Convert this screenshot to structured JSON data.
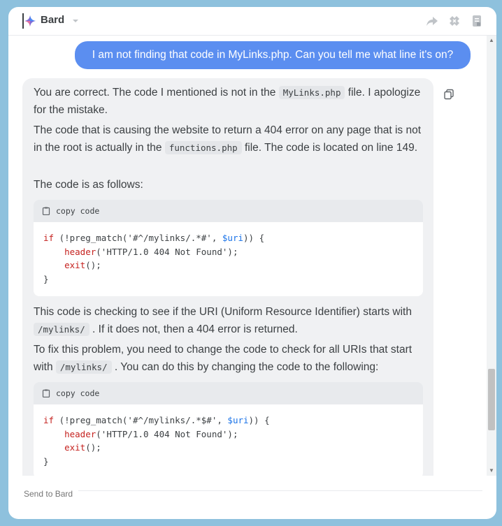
{
  "header": {
    "title": "Bard",
    "icons": [
      "sparkle-logo-icon",
      "chevron-down-icon",
      "share-icon",
      "extension-icon",
      "notes-icon"
    ]
  },
  "user_message": "I am not finding that code in MyLinks.php. Can you tell me what line it's on?",
  "response": {
    "p1_a": "You are correct. The code I mentioned is not in the ",
    "p1_code": "MyLinks.php",
    "p1_b": " file. I apologize for the mistake.",
    "p2_a": "The code that is causing the website to return a 404 error on any page that is not in the root is actually in the ",
    "p2_code": "functions.php",
    "p2_b": " file. The code is located on line 149.",
    "p3": "The code is as follows:",
    "copy_label": "copy code",
    "code1": {
      "l1_a": "if",
      "l1_b": " (!preg_match(",
      "l1_c": "'#^/mylinks/.*#'",
      "l1_d": ", ",
      "l1_e": "$uri",
      "l1_f": ")) {",
      "l2_a": "header",
      "l2_b": "(",
      "l2_c": "'HTTP/1.0 404 Not Found'",
      "l2_d": ");",
      "l3_a": "exit",
      "l3_b": "();",
      "l4": "}"
    },
    "p4_a": "This code is checking to see if the URI (Uniform Resource Identifier) starts with ",
    "p4_code": "/mylinks/",
    "p4_b": " . If it does not, then a 404 error is returned.",
    "p5_a": "To fix this problem, you need to change the code to check for all URIs that start with ",
    "p5_code": "/mylinks/",
    "p5_b": " . You can do this by changing the code to the following:",
    "code2": {
      "l1_a": "if",
      "l1_b": " (!preg_match(",
      "l1_c": "'#^/mylinks/.*$#'",
      "l1_d": ", ",
      "l1_e": "$uri",
      "l1_f": ")) {",
      "l2_a": "header",
      "l2_b": "(",
      "l2_c": "'HTTP/1.0 404 Not Found'",
      "l2_d": ");",
      "l3_a": "exit",
      "l3_b": "();",
      "l4": "}"
    }
  },
  "input": {
    "placeholder": "Send to Bard"
  },
  "colors": {
    "accent": "#5b8ef0",
    "background": "#8ec1dd",
    "card": "#f0f1f3",
    "keyword": "#c5221f",
    "variable": "#1a73e8"
  }
}
